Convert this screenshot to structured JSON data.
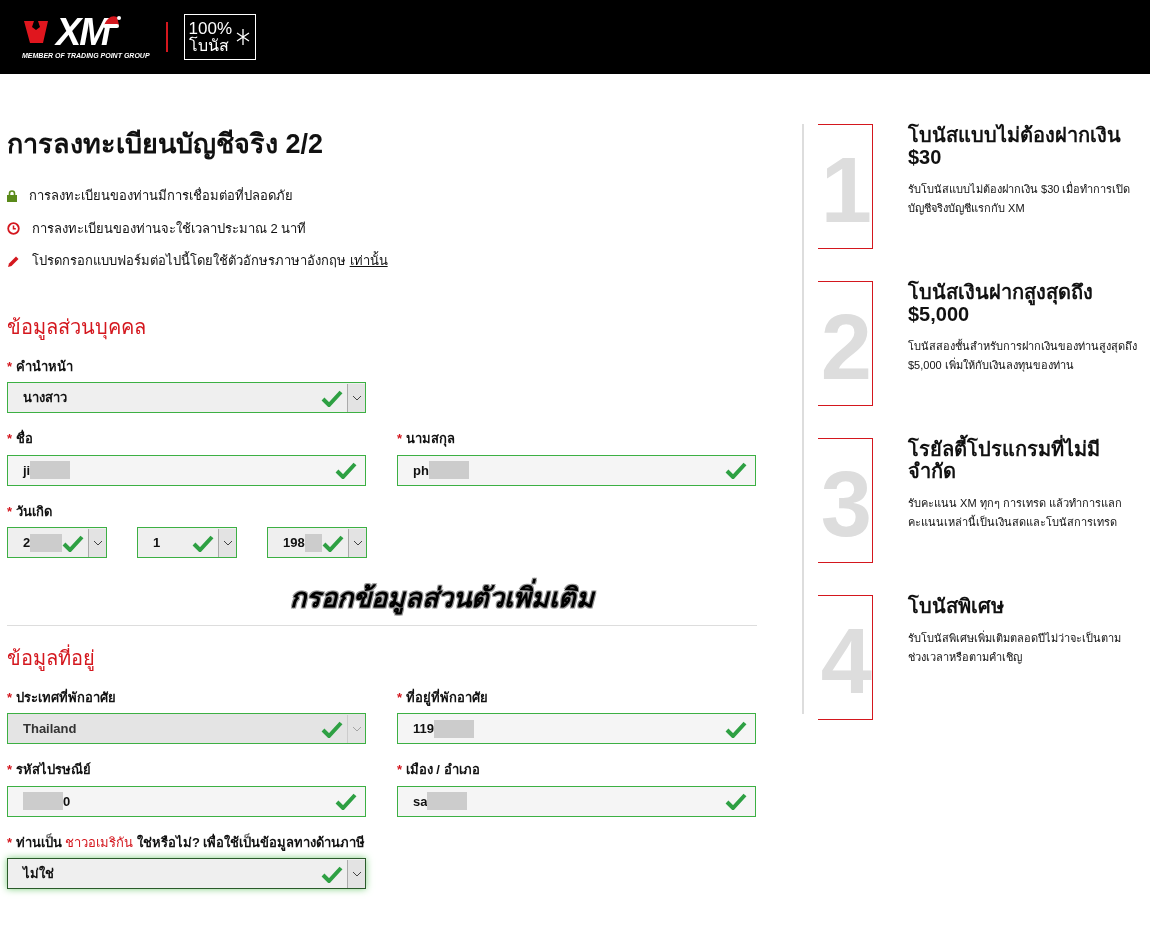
{
  "header": {
    "logo_text": "XM",
    "logo_tagline": "MEMBER OF TRADING POINT GROUP",
    "promo_percent": "100%",
    "promo_label": "โบนัส"
  },
  "page_title": "การลงทะเบียนบัญชีจริง 2/2",
  "notes": [
    {
      "kind": "lock",
      "text": "การลงทะเบียนของท่านมีการเชื่อมต่อที่ปลอดภัย"
    },
    {
      "kind": "clock",
      "text": "การลงทะเบียนของท่านจะใช้เวลาประมาณ 2 นาที"
    },
    {
      "kind": "pencil",
      "text": "โปรดกรอกแบบฟอร์มต่อไปนี้โดยใช้ตัวอักษรภาษาอังกฤษ",
      "link": "เท่านั้น"
    }
  ],
  "sections": [
    {
      "heading": "ข้อมูลส่วนบุคคล",
      "rows": [
        {
          "kind": "half",
          "fields": [
            {
              "marker": "*",
              "label": "คำนำหน้า",
              "kind": "select",
              "value": "นางสาว",
              "valid": true,
              "disabled": false,
              "focused": false,
              "redacted": false
            }
          ]
        },
        {
          "kind": "pair",
          "fields": [
            {
              "marker": "*",
              "label": "ชื่อ",
              "kind": "text",
              "value": "ji",
              "valid": true,
              "disabled": false,
              "focused": false,
              "redacted": true
            },
            {
              "marker": "*",
              "label": "นามสกุล",
              "kind": "text",
              "value": "ph",
              "valid": true,
              "disabled": false,
              "focused": false,
              "redacted": true
            }
          ]
        },
        {
          "kind": "date",
          "marker": "*",
          "label": "วันเกิด",
          "fields": [
            {
              "kind": "select",
              "value": "2",
              "valid": true,
              "disabled": false,
              "focused": false,
              "redacted": true
            },
            {
              "kind": "select",
              "value": "1",
              "valid": true,
              "disabled": false,
              "focused": false,
              "redacted": false
            },
            {
              "kind": "select",
              "value": "198",
              "valid": true,
              "disabled": false,
              "focused": false,
              "redacted": true
            }
          ]
        }
      ]
    },
    {
      "heading": "ข้อมูลที่อยู่",
      "rows": [
        {
          "kind": "pair",
          "fields": [
            {
              "marker": "*",
              "label": "ประเทศที่พักอาศัย",
              "kind": "select",
              "value": "Thailand",
              "valid": true,
              "disabled": true,
              "focused": false,
              "redacted": false
            },
            {
              "marker": "*",
              "label": "ที่อยู่ที่พักอาศัย",
              "kind": "text",
              "value": "119",
              "valid": true,
              "disabled": false,
              "focused": false,
              "redacted": true
            }
          ]
        },
        {
          "kind": "pair",
          "fields": [
            {
              "marker": "*",
              "label": "รหัสไปรษณีย์",
              "kind": "text",
              "value": "0",
              "valid": true,
              "disabled": false,
              "focused": false,
              "redacted": true,
              "redact_before": true
            },
            {
              "marker": "*",
              "label": "เมือง / อำเภอ",
              "kind": "text",
              "value": "sa",
              "valid": true,
              "disabled": false,
              "focused": false,
              "redacted": true
            }
          ]
        },
        {
          "kind": "half",
          "fields": [
            {
              "marker": "*",
              "label": "ท่านเป็น **ชาวอเมริกัน** ใช่หรือไม่? เพื่อใช้เป็นข้อมูลทางด้านภาษี",
              "kind": "select",
              "value": "ไม่ใช่",
              "valid": true,
              "disabled": false,
              "focused": true,
              "redacted": false
            }
          ]
        }
      ]
    }
  ],
  "overlay_caption": "กรอกข้อมูลส่วนตัวเพิ่มเติม",
  "benefits": [
    {
      "number": "1",
      "title": "โบนัสแบบไม่ต้องฝากเงิน $30",
      "text": "รับโบนัสแบบไม่ต้องฝากเงิน $30 เมื่อทำการเปิดบัญชีจริงบัญชีแรกกับ XM"
    },
    {
      "number": "2",
      "title": "โบนัสเงินฝากสูงสุดถึง $5,000",
      "text": "โบนัสสองชั้นสำหรับการฝากเงินของท่านสูงสุดถึง $5,000 เพิ่มให้กับเงินลงทุนของท่าน"
    },
    {
      "number": "3",
      "title": "โรยัลตี้โปรแกรมที่ไม่มีจำกัด",
      "text": "รับคะแนน XM ทุกๆ การเทรด แล้วทำการแลกคะแนนเหล่านี้เป็นเงินสดและโบนัสการเทรด"
    },
    {
      "number": "4",
      "title": "โบนัสพิเศษ",
      "text": "รับโบนัสพิเศษเพิ่มเติมตลอดปีไม่ว่าจะเป็นตามช่วงเวลาหรือตามคำเชิญ"
    }
  ]
}
